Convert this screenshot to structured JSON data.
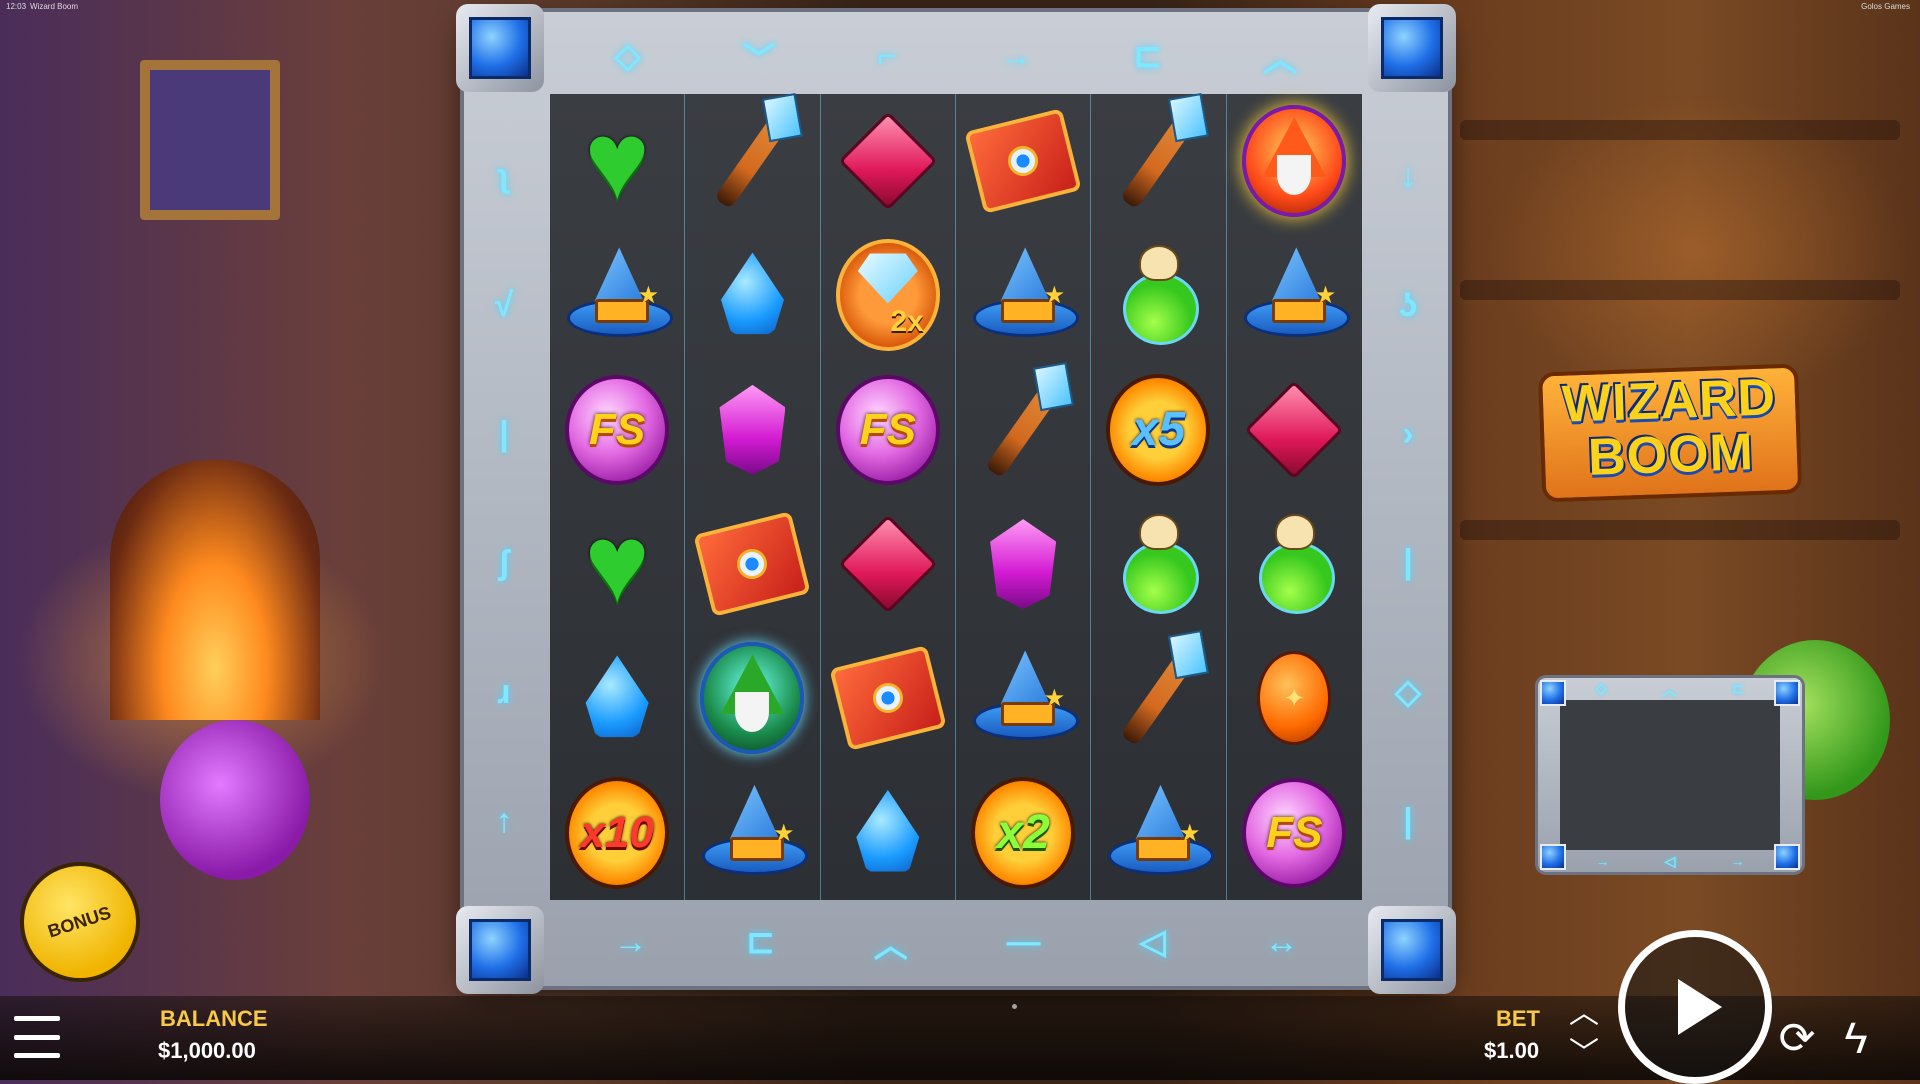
{
  "topbar": {
    "clock": "12:03",
    "game_name": "Wizard Boom",
    "studio": "Golos Games"
  },
  "reels": {
    "rows": [
      [
        {
          "icon": "green-heart-icon"
        },
        {
          "icon": "magic-wand-icon"
        },
        {
          "icon": "pink-ruby-icon"
        },
        {
          "icon": "spell-book-icon"
        },
        {
          "icon": "magic-wand-icon"
        },
        {
          "icon": "fire-wizard-icon"
        }
      ],
      [
        {
          "icon": "wizard-hat-icon"
        },
        {
          "icon": "blue-sapphire-icon"
        },
        {
          "icon": "diamond-multiplier-icon",
          "label": "2x"
        },
        {
          "icon": "wizard-hat-icon"
        },
        {
          "icon": "skull-potion-icon"
        },
        {
          "icon": "wizard-hat-icon"
        }
      ],
      [
        {
          "icon": "free-spins-orb-icon",
          "label": "FS"
        },
        {
          "icon": "purple-amethyst-icon"
        },
        {
          "icon": "free-spins-orb-icon",
          "label": "FS"
        },
        {
          "icon": "magic-wand-icon"
        },
        {
          "icon": "multiplier-coin-icon",
          "label": "x5"
        },
        {
          "icon": "pink-ruby-icon"
        }
      ],
      [
        {
          "icon": "green-heart-icon"
        },
        {
          "icon": "spell-book-icon"
        },
        {
          "icon": "pink-ruby-icon"
        },
        {
          "icon": "purple-amethyst-icon"
        },
        {
          "icon": "skull-potion-icon"
        },
        {
          "icon": "skull-potion-icon"
        }
      ],
      [
        {
          "icon": "blue-sapphire-icon"
        },
        {
          "icon": "green-wizard-icon"
        },
        {
          "icon": "spell-book-icon"
        },
        {
          "icon": "wizard-hat-icon"
        },
        {
          "icon": "magic-wand-icon"
        },
        {
          "icon": "orange-amber-icon"
        }
      ],
      [
        {
          "icon": "multiplier-coin-icon",
          "label": "x10"
        },
        {
          "icon": "wizard-hat-icon"
        },
        {
          "icon": "blue-sapphire-icon"
        },
        {
          "icon": "multiplier-coin-icon",
          "label": "x2"
        },
        {
          "icon": "wizard-hat-icon"
        },
        {
          "icon": "free-spins-orb-icon",
          "label": "FS"
        }
      ]
    ]
  },
  "logo": {
    "line1": "WIZARD",
    "line2": "BOOM"
  },
  "bonus_button": {
    "label": "BONUS"
  },
  "balance": {
    "label": "BALANCE",
    "value": "$1,000.00"
  },
  "bet": {
    "label": "BET",
    "value": "$1.00"
  },
  "icons": {
    "menu": "hamburger-menu-icon",
    "bet_up": "chevron-up-icon",
    "bet_down": "chevron-down-icon",
    "spin": "play-icon",
    "autoplay": "autoplay-icon",
    "turbo": "lightning-icon"
  },
  "colors": {
    "label_gold": "#f7c84a",
    "rune_cyan": "#7fe7ff",
    "frame_silver": "#c9ced6"
  }
}
